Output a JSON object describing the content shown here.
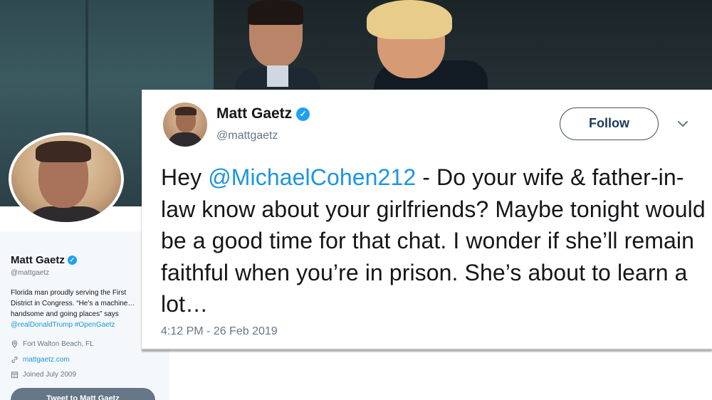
{
  "profile": {
    "name": "Matt Gaetz",
    "handle": "@mattgaetz",
    "bio_part1": "Florida man proudly serving the First District in Congress. “He’s a machine…handsome and going places” says ",
    "bio_mention": "@realDonaldTrump",
    "bio_hashtag": "#OpenGaetz",
    "location": "Fort Walton Beach, FL",
    "website": "mattgaetz.com",
    "joined": "Joined July 2009",
    "tweet_to_label": "Tweet to Matt Gaetz",
    "icons": [
      "location-pin-icon",
      "link-icon",
      "calendar-icon",
      "verified-badge-icon"
    ]
  },
  "tweet": {
    "author_name": "Matt Gaetz",
    "author_handle": "@mattgaetz",
    "follow_label": "Follow",
    "text_prefix": "Hey ",
    "mention": "@MichaelCohen212",
    "text_body": " - Do your wife & father-in-law know about your girlfriends? Maybe tonight would be a good time for that chat. I wonder if she’ll remain faithful when you’re in prison.  She’s about to learn a lot…",
    "timestamp": "4:12 PM - 26 Feb 2019"
  },
  "colors": {
    "link": "#1b95e0",
    "verified": "#1da1f2",
    "muted": "#657786",
    "text": "#14171a"
  }
}
